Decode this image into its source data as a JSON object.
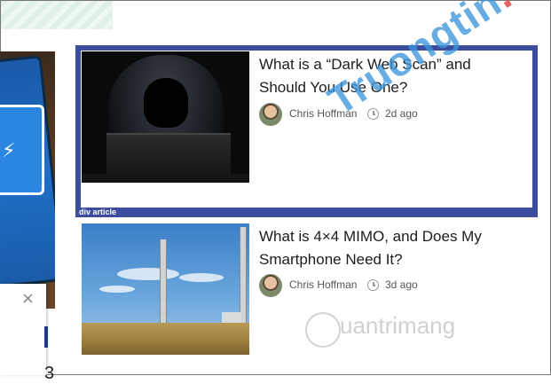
{
  "articles": [
    {
      "title": "What is a “Dark Web Scan” and Should You Use One?",
      "author": "Chris Hoffman",
      "time": "2d ago",
      "image": "hooded-hacker-laptop"
    },
    {
      "title": "What is 4×4 MIMO, and Does My Smartphone Need It?",
      "author": "Chris Hoffman",
      "time": "3d ago",
      "image": "cell-towers-landscape"
    }
  ],
  "highlight": {
    "label": "div article",
    "color": "#3c4da0"
  },
  "popup": {
    "close_icon": "×",
    "partial_text": "3"
  },
  "watermarks": {
    "top_main": "Truongtin",
    "top_dot": ".top",
    "bottom": "uantrimang"
  },
  "colors": {
    "highlight": "#3c4da0",
    "watermark_blue": "#3c96dc",
    "watermark_red": "#e64646"
  }
}
